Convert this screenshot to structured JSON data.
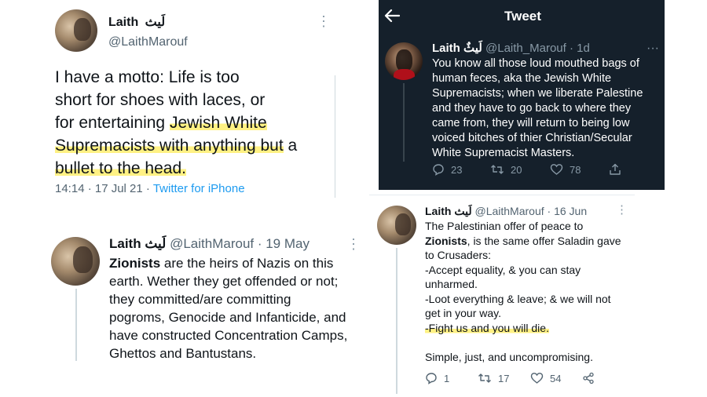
{
  "tweet1": {
    "name": "Laith",
    "arabic_name": "لَيث",
    "handle": "@LaithMarouf",
    "text_plain_1": "I have a motto: Life is too",
    "text_plain_2": "short for shoes with laces, or",
    "text_plain_3": "for entertaining",
    "text_hl_3": "Jewish White",
    "text_hl_4a": "Supremacists with anything but",
    "text_plain_4b": "a",
    "text_hl_5": "bullet to the head.",
    "time": "14:14 · 17 Jul 21 ·",
    "source": "Twitter for iPhone"
  },
  "tweet2": {
    "name": "Laith",
    "arabic_name": "لَيث",
    "meta": "@LaithMarouf · 19 May",
    "bold_word": "Zionists",
    "line1_rest": "are the heirs of Nazis on this",
    "line2": "earth. Wether they get offended or not;",
    "line3": "they committed/are committing",
    "line4": "pogroms, Genocide and Infanticide, and",
    "line5": "have constructed Concentration Camps,",
    "line6": "Ghettos and Bantustans."
  },
  "tweet3": {
    "header_title": "Tweet",
    "name": "Laith",
    "arabic_name": "لَيثٌ",
    "meta": "@Laith_Marouf · 1d",
    "lines": [
      "You know all those loud mouthed bags of",
      "human feces, aka the Jewish White",
      "Supremacists; when we liberate Palestine",
      "and they have to go back to where they",
      "came from, they will return to being low",
      "voiced bitches of thier Christian/Secular",
      "White Supremacist Masters."
    ],
    "replies": "23",
    "retweets": "20",
    "likes": "78"
  },
  "tweet4": {
    "name": "Laith",
    "arabic_name": "لَيث",
    "meta": "@LaithMarouf · 16 Jun",
    "line1": "The Palestinian offer of peace to",
    "bold_word": "Zionists",
    "line2_rest": ", is the same offer Saladin gave",
    "line3": "to Crusaders:",
    "line4": "-Accept equality, & you can stay",
    "line5": "unharmed.",
    "line6": "-Loot everything & leave; & we will not",
    "line7": "get in your way.",
    "line8": "-Fight us and you will die.",
    "line9": "Simple, just, and uncompromising.",
    "replies": "1",
    "retweets": "17",
    "likes": "54"
  },
  "colors": {
    "link": "#1d9bf0",
    "dark_bg": "#15202b",
    "highlight": "#ffec5a"
  }
}
